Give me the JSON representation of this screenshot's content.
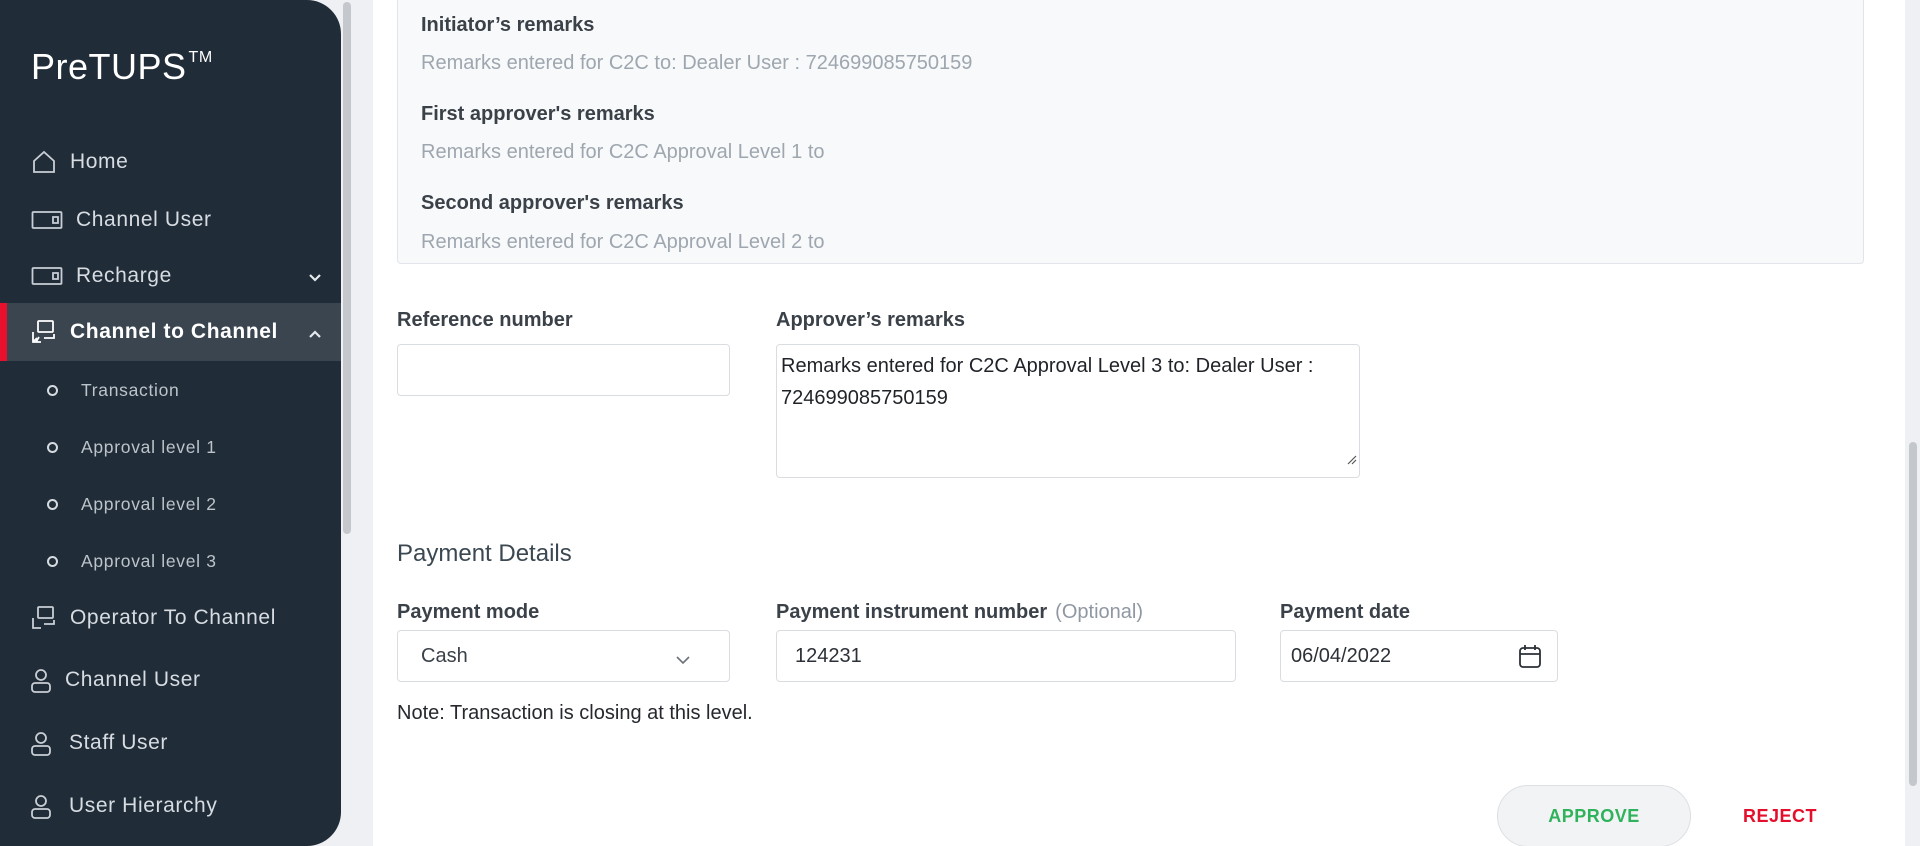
{
  "brand": {
    "name": "PreTUPS",
    "mark": "TM"
  },
  "sidebar": {
    "items": [
      {
        "label": "Home",
        "icon": "home-icon"
      },
      {
        "label": "Channel User",
        "icon": "card-icon"
      },
      {
        "label": "Recharge",
        "icon": "card-icon",
        "expandable": true,
        "expanded": false
      },
      {
        "label": "Channel to Channel",
        "icon": "transfer-icon",
        "expandable": true,
        "expanded": true,
        "active": true
      },
      {
        "label": "Operator To Channel",
        "icon": "transfer-icon"
      },
      {
        "label": "Channel User",
        "icon": "user-icon"
      },
      {
        "label": "Staff User",
        "icon": "user-icon"
      },
      {
        "label": "User Hierarchy",
        "icon": "user-icon"
      }
    ],
    "subitems": [
      {
        "label": "Transaction"
      },
      {
        "label": "Approval level 1"
      },
      {
        "label": "Approval level 2"
      },
      {
        "label": "Approval level 3"
      }
    ]
  },
  "remarks": {
    "initiator_label": "Initiator’s remarks",
    "initiator_value": "Remarks entered for C2C to: Dealer User : 724699085750159",
    "first_label": "First approver's remarks",
    "first_value": "Remarks entered for C2C Approval Level 1 to",
    "second_label": "Second approver's remarks",
    "second_value": "Remarks entered for C2C Approval Level 2 to"
  },
  "form": {
    "reference_label": "Reference number",
    "reference_value": "",
    "approver_label": "Approver’s remarks",
    "approver_value": "Remarks entered for C2C Approval Level 3 to: Dealer User : 724699085750159"
  },
  "payment": {
    "title": "Payment Details",
    "mode_label": "Payment mode",
    "mode_value": "Cash",
    "instrument_label": "Payment instrument number",
    "instrument_optional": "(Optional)",
    "instrument_value": "124231",
    "date_label": "Payment date",
    "date_value": "06/04/2022"
  },
  "note": "Note: Transaction is closing at this level.",
  "actions": {
    "approve": "APPROVE",
    "reject": "REJECT"
  },
  "colors": {
    "sidebar_bg": "#202c37",
    "active_marker": "#e8112d",
    "approve": "#2fb25b",
    "reject": "#e30f2c"
  }
}
